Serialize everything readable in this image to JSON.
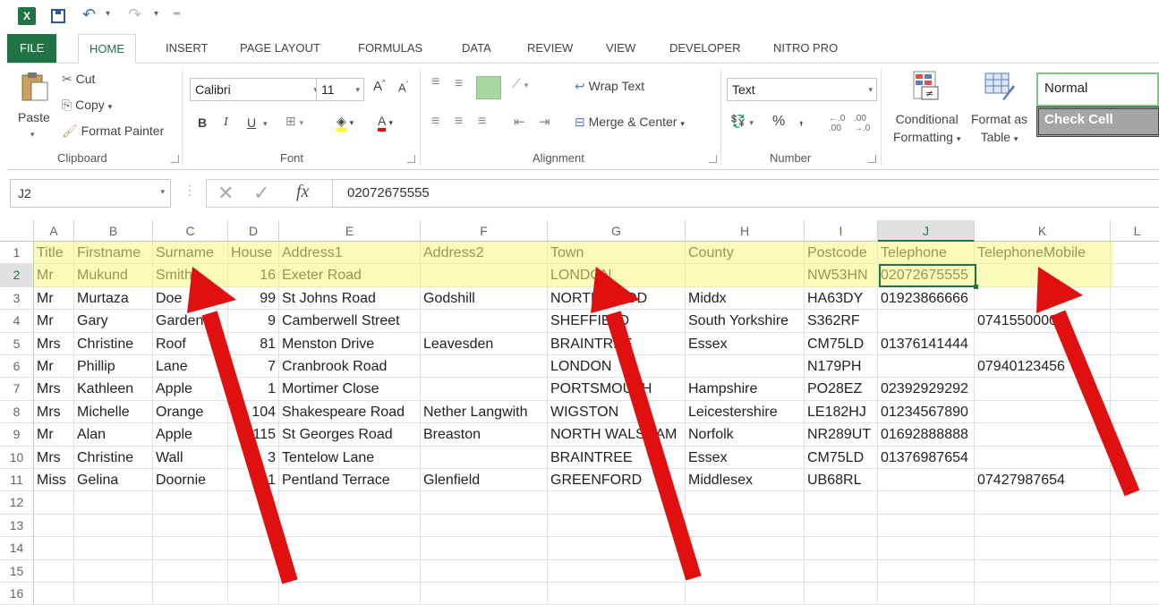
{
  "qat": {
    "app_icon": "X",
    "undo": "↶",
    "redo": "↷"
  },
  "tabs": [
    "FILE",
    "HOME",
    "INSERT",
    "PAGE LAYOUT",
    "FORMULAS",
    "DATA",
    "REVIEW",
    "VIEW",
    "DEVELOPER",
    "NITRO PRO"
  ],
  "ribbon": {
    "clipboard": {
      "paste": "Paste",
      "cut": "Cut",
      "copy": "Copy",
      "format_painter": "Format Painter",
      "label": "Clipboard"
    },
    "font": {
      "name": "Calibri",
      "size": "11",
      "bold": "B",
      "italic": "I",
      "underline": "U",
      "label": "Font"
    },
    "alignment": {
      "wrap": "Wrap Text",
      "merge": "Merge & Center",
      "label": "Alignment"
    },
    "number": {
      "format": "Text",
      "percent": "%",
      "comma": ",",
      "label": "Number"
    },
    "styles": {
      "conditional": [
        "Conditional",
        "Formatting"
      ],
      "format_table": [
        "Format as",
        "Table"
      ],
      "style_normal": "Normal",
      "style_check": "Check Cell"
    }
  },
  "formula_bar": {
    "name_box": "J2",
    "fx": "fx",
    "value": "02072675555"
  },
  "columns": [
    "A",
    "B",
    "C",
    "D",
    "E",
    "F",
    "G",
    "H",
    "I",
    "J",
    "K",
    "L"
  ],
  "rows": [
    [
      "Title",
      "Firstname",
      "Surname",
      "House",
      "Address1",
      "Address2",
      "Town",
      "County",
      "Postcode",
      "Telephone",
      "TelephoneMobile"
    ],
    [
      "Mr",
      "Mukund",
      "Smith",
      "16",
      "Exeter Road",
      "",
      "LONDON",
      "",
      "NW53HN",
      "02072675555",
      ""
    ],
    [
      "Mr",
      "Murtaza",
      "Doe",
      "99",
      "St Johns Road",
      "Godshill",
      "NORTHWOOD",
      "Middx",
      "HA63DY",
      "01923866666",
      ""
    ],
    [
      "Mr",
      "Gary",
      "Gardener",
      "9",
      "Camberwell Street",
      "",
      "SHEFFIELD",
      "South Yorkshire",
      "S362RF",
      "",
      "07415500000"
    ],
    [
      "Mrs",
      "Christine",
      "Roof",
      "81",
      "Menston Drive",
      "Leavesden",
      "BRAINTREE",
      "Essex",
      "CM75LD",
      "01376141444",
      ""
    ],
    [
      "Mr",
      "Phillip",
      "Lane",
      "7",
      "Cranbrook Road",
      "",
      "LONDON",
      "",
      "N179PH",
      "",
      "07940123456"
    ],
    [
      "Mrs",
      "Kathleen",
      "Apple",
      "1",
      "Mortimer Close",
      "",
      "PORTSMOUTH",
      "Hampshire",
      "PO28EZ",
      "02392929292",
      ""
    ],
    [
      "Mrs",
      "Michelle",
      "Orange",
      "104",
      "Shakespeare Road",
      "Nether Langwith",
      "WIGSTON",
      "Leicestershire",
      "LE182HJ",
      "01234567890",
      ""
    ],
    [
      "Mr",
      "Alan",
      "Apple",
      "115",
      "St Georges Road",
      "Breaston",
      "NORTH WALSHAM",
      "Norfolk",
      "NR289UT",
      "01692888888",
      ""
    ],
    [
      "Mrs",
      "Christine",
      "Wall",
      "3",
      "Tentelow Lane",
      "",
      "BRAINTREE",
      "Essex",
      "CM75LD",
      "01376987654",
      ""
    ],
    [
      "Miss",
      "Gelina",
      "Doornie",
      "11",
      "Pentland Terrace",
      "Glenfield",
      "GREENFORD",
      "Middlesex",
      "UB68RL",
      "",
      "07427987654"
    ],
    [
      "",
      "",
      "",
      "",
      "",
      "",
      "",
      "",
      "",
      "",
      ""
    ],
    [
      "",
      "",
      "",
      "",
      "",
      "",
      "",
      "",
      "",
      "",
      ""
    ],
    [
      "",
      "",
      "",
      "",
      "",
      "",
      "",
      "",
      "",
      "",
      ""
    ],
    [
      "",
      "",
      "",
      "",
      "",
      "",
      "",
      "",
      "",
      "",
      ""
    ],
    [
      "",
      "",
      "",
      "",
      "",
      "",
      "",
      "",
      "",
      "",
      ""
    ]
  ],
  "colors": {
    "excel_green": "#217346",
    "highlight": "#f5f582",
    "arrow": "#e01010"
  }
}
